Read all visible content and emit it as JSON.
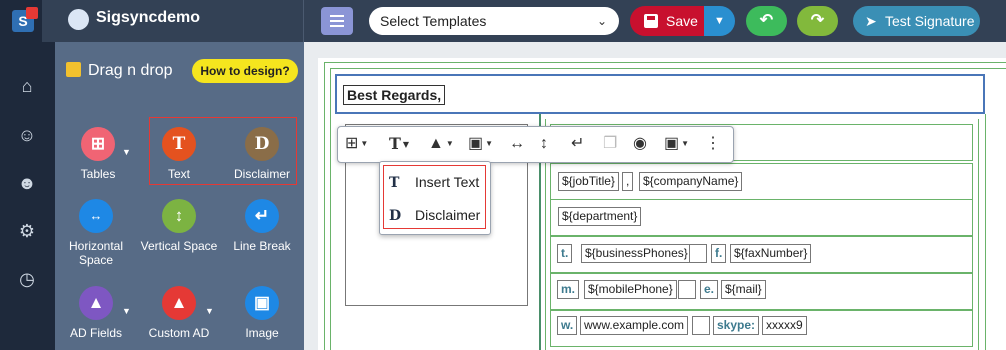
{
  "header": {
    "org_name": "Sigsyncdemo",
    "template_select": {
      "value": "Select Templates"
    },
    "save_label": "Save",
    "test_signature_label": "Test Signature",
    "colors": {
      "bar": "#334155",
      "save": "#c8102e",
      "save_dropdown": "#2a8fd0",
      "undo": "#3dbb5c",
      "redo": "#82b93c",
      "test": "#3a8fb5"
    }
  },
  "rail": {
    "items": [
      {
        "icon": "home-icon"
      },
      {
        "icon": "users-icon"
      },
      {
        "icon": "user-settings-icon"
      },
      {
        "icon": "gear-icon"
      },
      {
        "icon": "clock-icon"
      }
    ]
  },
  "palette": {
    "title": "Drag n drop",
    "how_to_label": "How to design?",
    "items": [
      {
        "label": "Tables",
        "icon": "table-icon",
        "color": "#f06474",
        "has_dropdown": true
      },
      {
        "label": "Text",
        "icon": "text-icon",
        "glyph": "T",
        "color": "#e4521f",
        "selected": true
      },
      {
        "label": "Disclaimer",
        "icon": "disclaimer-icon",
        "glyph": "D",
        "color": "#8a6d48",
        "selected": true
      },
      {
        "label": "Horizontal Space",
        "icon": "horizontal-space-icon",
        "color": "#1e88e5"
      },
      {
        "label": "Vertical Space",
        "icon": "vertical-space-icon",
        "color": "#7cb342"
      },
      {
        "label": "Line Break",
        "icon": "line-break-icon",
        "color": "#1e88e5"
      },
      {
        "label": "AD Fields",
        "icon": "ad-fields-icon",
        "color": "#7e57c2",
        "has_dropdown": true
      },
      {
        "label": "Custom AD",
        "icon": "custom-ad-icon",
        "color": "#e53935",
        "has_dropdown": true
      },
      {
        "label": "Image",
        "icon": "image-icon",
        "color": "#1e88e5"
      }
    ]
  },
  "editor": {
    "regards_text": "Best Regards,",
    "rows": [
      {
        "tags": [
          "${jobTitle}",
          ",",
          "${companyName}"
        ]
      },
      {
        "tags": [
          "${department}"
        ]
      },
      {
        "phone_label": "t.",
        "phone": "${businessPhones}",
        "fax_label": "f.",
        "fax": "${faxNumber}"
      },
      {
        "mobile_label": "m.",
        "mobile": "${mobilePhone}",
        "email_label": "e.",
        "email": "${mail}"
      },
      {
        "web_label": "w.",
        "web": "www.example.com",
        "skype_label": "skype:",
        "skype": "xxxxx9"
      }
    ]
  },
  "float_toolbar": {
    "buttons": [
      {
        "icon": "table-icon",
        "dropdown": true
      },
      {
        "icon": "text-icon",
        "dropdown": true
      },
      {
        "icon": "ad-icon",
        "dropdown": true
      },
      {
        "icon": "image-icon",
        "dropdown": true
      },
      {
        "icon": "horizontal-space-icon"
      },
      {
        "icon": "vertical-space-icon"
      },
      {
        "icon": "line-break-icon"
      },
      {
        "icon": "paste-icon",
        "disabled": true
      },
      {
        "icon": "eye-icon"
      },
      {
        "icon": "save-icon",
        "dropdown": true
      },
      {
        "icon": "more-icon"
      }
    ]
  },
  "insert_menu": {
    "items": [
      {
        "label": "Insert Text",
        "icon": "text-icon",
        "glyph": "T"
      },
      {
        "label": "Disclaimer",
        "icon": "disclaimer-icon",
        "glyph": "D"
      }
    ]
  }
}
